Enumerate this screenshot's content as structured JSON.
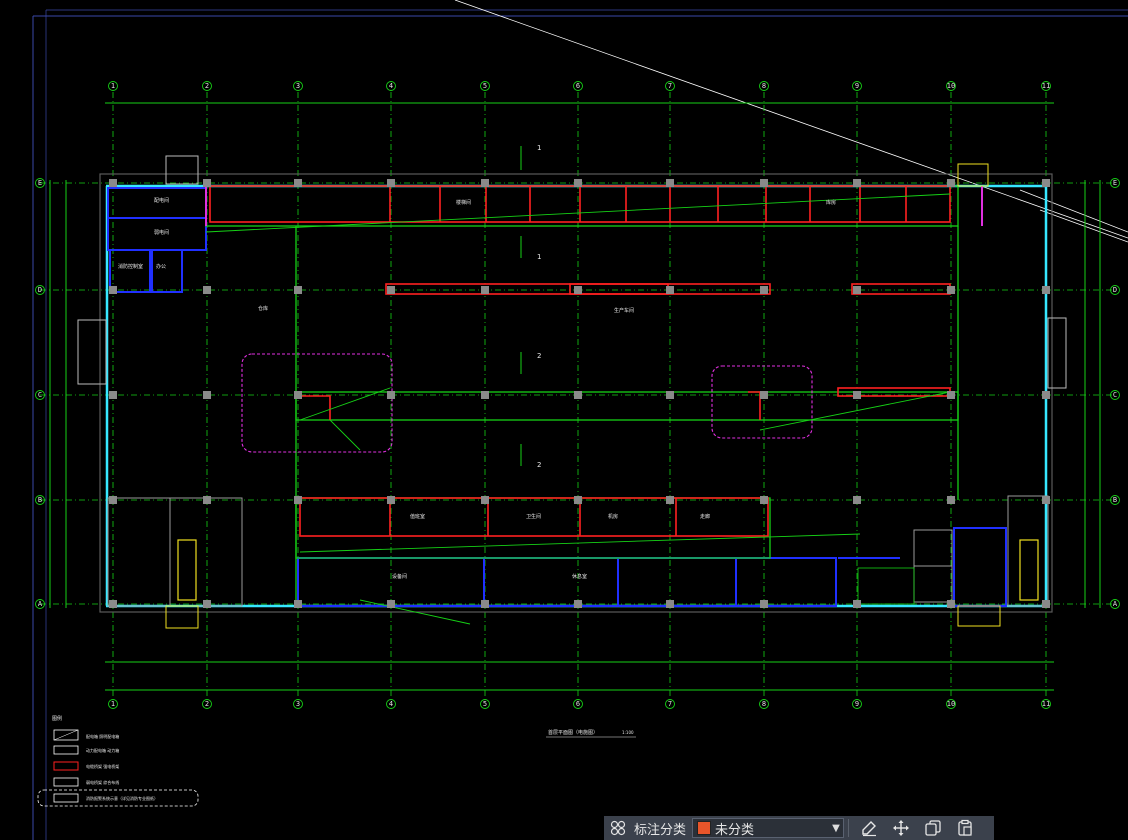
{
  "drawing": {
    "title": "首层平面图（电施图）",
    "scale": "1:100",
    "column_axes_top": [
      "1",
      "2",
      "3",
      "4",
      "5",
      "6",
      "7",
      "8",
      "9",
      "10",
      "11"
    ],
    "row_axes_left": [
      "E",
      "D",
      "C",
      "B",
      "A"
    ],
    "room_labels": [
      "配电间",
      "弱电间",
      "消防控制室",
      "办公",
      "楼梯间",
      "库房",
      "生产车间",
      "仓库",
      "值班室",
      "卫生间",
      "机房",
      "走廊",
      "设备间",
      "休息室"
    ],
    "section_marks": [
      "1",
      "1",
      "2",
      "2"
    ],
    "legend": {
      "title": "图例",
      "items": [
        "配电箱  照明配电箱",
        "动力配电箱  动力箱",
        "电缆桥架  强电桥架",
        "弱电桥架  综合布线",
        "消防报警系统示意（详见消防专业图纸）"
      ]
    }
  },
  "statusbar": {
    "category_icon": "category-grid-icon",
    "category_label": "标注分类",
    "category_value": "未分类",
    "category_color": "#e8552a",
    "tools": [
      "edit-annotation-icon",
      "move-icon",
      "copy-icon",
      "paste-icon"
    ]
  },
  "colors": {
    "background": "#000000",
    "grid": "#16d116",
    "wall": "#36e7ff",
    "partition": "#2030ff",
    "tray_red": "#ff2020",
    "magenta": "#e030e0",
    "yellow": "#f0e020",
    "white": "#e8e8e8",
    "column": "#8a8a8a"
  }
}
